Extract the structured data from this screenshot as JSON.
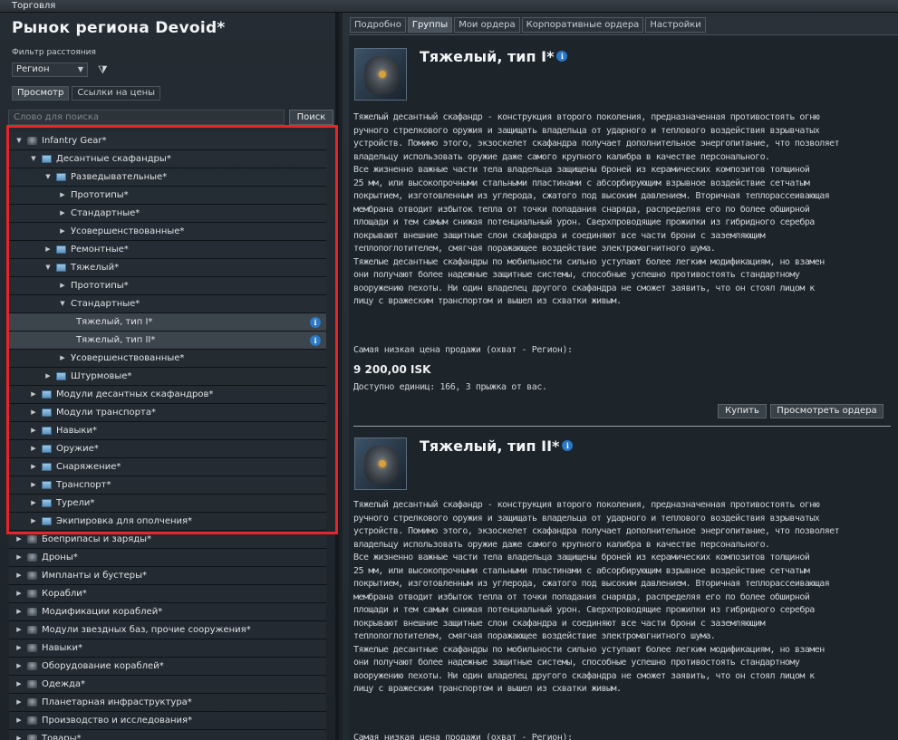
{
  "window": {
    "title": "Торговля"
  },
  "left": {
    "region_title": "Рынок региона Devoid*",
    "filter_label": "Фильтр расстояния",
    "region_select": "Регион",
    "subtabs": [
      "Просмотр",
      "Ссылки на цены"
    ],
    "search": {
      "placeholder": "Слово для поиска",
      "button": "Поиск"
    },
    "tree": [
      {
        "label": "Infantry Gear*",
        "depth": 0,
        "expanded": true,
        "icon": "gear-icon"
      },
      {
        "label": "Десантные скафандры*",
        "depth": 1,
        "expanded": true,
        "icon": "folder-icon"
      },
      {
        "label": "Разведывательные*",
        "depth": 2,
        "expanded": true,
        "icon": "folder-icon"
      },
      {
        "label": "Прототипы*",
        "depth": 3,
        "expanded": false,
        "icon": "none"
      },
      {
        "label": "Стандартные*",
        "depth": 3,
        "expanded": false,
        "icon": "none"
      },
      {
        "label": "Усовершенствованные*",
        "depth": 3,
        "expanded": false,
        "icon": "none"
      },
      {
        "label": "Ремонтные*",
        "depth": 2,
        "expanded": false,
        "icon": "folder-icon"
      },
      {
        "label": "Тяжелый*",
        "depth": 2,
        "expanded": true,
        "icon": "folder-icon"
      },
      {
        "label": "Прототипы*",
        "depth": 3,
        "expanded": false,
        "icon": "none"
      },
      {
        "label": "Стандартные*",
        "depth": 3,
        "expanded": true,
        "icon": "none"
      },
      {
        "label": "Тяжелый, тип I*",
        "depth": 4,
        "leaf": true,
        "info": true,
        "selected": true
      },
      {
        "label": "Тяжелый, тип II*",
        "depth": 4,
        "leaf": true,
        "info": true,
        "selected": true
      },
      {
        "label": "Усовершенствованные*",
        "depth": 3,
        "expanded": false,
        "icon": "none"
      },
      {
        "label": "Штурмовые*",
        "depth": 2,
        "expanded": false,
        "icon": "folder-icon"
      },
      {
        "label": "Модули десантных скафандров*",
        "depth": 1,
        "expanded": false,
        "icon": "folder-icon"
      },
      {
        "label": "Модули транспорта*",
        "depth": 1,
        "expanded": false,
        "icon": "folder-icon"
      },
      {
        "label": "Навыки*",
        "depth": 1,
        "expanded": false,
        "icon": "folder-icon"
      },
      {
        "label": "Оружие*",
        "depth": 1,
        "expanded": false,
        "icon": "folder-icon"
      },
      {
        "label": "Снаряжение*",
        "depth": 1,
        "expanded": false,
        "icon": "folder-icon"
      },
      {
        "label": "Транспорт*",
        "depth": 1,
        "expanded": false,
        "icon": "folder-icon"
      },
      {
        "label": "Турели*",
        "depth": 1,
        "expanded": false,
        "icon": "folder-icon"
      },
      {
        "label": "Экипировка для ополчения*",
        "depth": 1,
        "expanded": false,
        "icon": "folder-icon"
      },
      {
        "label": "Боеприпасы и заряды*",
        "depth": 0,
        "expanded": false,
        "icon": "ammo-icon"
      },
      {
        "label": "Дроны*",
        "depth": 0,
        "expanded": false,
        "icon": "drone-icon"
      },
      {
        "label": "Импланты и бустеры*",
        "depth": 0,
        "expanded": false,
        "icon": "implant-icon"
      },
      {
        "label": "Корабли*",
        "depth": 0,
        "expanded": false,
        "icon": "ship-icon"
      },
      {
        "label": "Модификации кораблей*",
        "depth": 0,
        "expanded": false,
        "icon": "ship-mod-icon"
      },
      {
        "label": "Модули звездных баз, прочие сооружения*",
        "depth": 0,
        "expanded": false,
        "icon": "starbase-icon"
      },
      {
        "label": "Навыки*",
        "depth": 0,
        "expanded": false,
        "icon": "skillbook-icon"
      },
      {
        "label": "Оборудование кораблей*",
        "depth": 0,
        "expanded": false,
        "icon": "equipment-icon"
      },
      {
        "label": "Одежда*",
        "depth": 0,
        "expanded": false,
        "icon": "clothing-icon"
      },
      {
        "label": "Планетарная инфраструктура*",
        "depth": 0,
        "expanded": false,
        "icon": "planet-icon"
      },
      {
        "label": "Производство и исследования*",
        "depth": 0,
        "expanded": false,
        "icon": "industry-icon"
      },
      {
        "label": "Товары*",
        "depth": 0,
        "expanded": false,
        "icon": "trade-goods-icon"
      }
    ]
  },
  "right": {
    "tabs": [
      "Подробно",
      "Группы",
      "Мои ордера",
      "Корпоративные ордера",
      "Настройки"
    ],
    "active_tab": "Группы",
    "items": [
      {
        "title": "Тяжелый, тип I*",
        "description": "Тяжелый десантный скафандр - конструкция второго поколения, предназначенная противостоять огню\nручного стрелкового оружия и защищать владельца от ударного и теплового воздействия взрывчатых\nустройств. Помимо этого, экзоскелет скафандра получает дополнительное энергопитание, что позволяет\nвладельцу использовать оружие даже самого крупного калибра в качестве персонального.\nВсе жизненно важные части тела владельца защищены броней из керамических композитов толщиной\n25 мм, или высокопрочными стальными пластинами с абсорбирующим взрывное воздействие сетчатым\nпокрытием, изготовленным из углерода, сжатого под высоким давлением. Вторичная теплорассеивающая\nмембрана отводит избыток тепла от точки попадания снаряда, распределяя его по более обширной\nплощади и тем самым снижая потенциальный урон. Сверхпроводящие прожилки из гибридного серебра\nпокрывают внешние защитные слои скафандра и соединяют все части брони с заземляющим\nтеплопоглотителем, смягчая поражающее воздействие электромагнитного шума.\nТяжелые десантные скафандры по мобильности сильно уступают более легким модификациям, но взамен\nони получают более надежные защитные системы, способные успешно противостоять стандартному\nвооружению пехоты. Ни один владелец другого скафандра не сможет заявить, что он стоял лицом к\nлицу с вражеским транспортом и вышел из схватки живым.",
        "price_label": "Самая низкая цена продажи (охват - Регион):",
        "price": "9 200,00 ISK",
        "availability": "Доступно единиц: 166, 3 прыжка от вас.",
        "buy_button": "Купить",
        "orders_button": "Просмотреть ордера"
      },
      {
        "title": "Тяжелый, тип II*",
        "description": "Тяжелый десантный скафандр - конструкция второго поколения, предназначенная противостоять огню\nручного стрелкового оружия и защищать владельца от ударного и теплового воздействия взрывчатых\nустройств. Помимо этого, экзоскелет скафандра получает дополнительное энергопитание, что позволяет\nвладельцу использовать оружие даже самого крупного калибра в качестве персонального.\nВсе жизненно важные части тела владельца защищены броней из керамических композитов толщиной\n25 мм, или высокопрочными стальными пластинами с абсорбирующим взрывное воздействие сетчатым\nпокрытием, изготовленным из углерода, сжатого под высоким давлением. Вторичная теплорассеивающая\nмембрана отводит избыток тепла от точки попадания снаряда, распределяя его по более обширной\nплощади и тем самым снижая потенциальный урон. Сверхпроводящие прожилки из гибридного серебра\nпокрывают внешние защитные слои скафандра и соединяют все части брони с заземляющим\nтеплопоглотителем, смягчая поражающее воздействие электромагнитного шума.\nТяжелые десантные скафандры по мобильности сильно уступают более легким модификациям, но взамен\nони получают более надежные защитные системы, способные успешно противостоять стандартному\nвооружению пехоты. Ни один владелец другого скафандра не сможет заявить, что он стоял лицом к\nлицу с вражеским транспортом и вышел из схватки живым.",
        "price_label": "Самая низкая цена продажи (охват - Регион):"
      }
    ]
  },
  "colors": {
    "highlight_box": "#e8232a",
    "info_icon": "#2a78c8",
    "folder": "#7fb3da"
  }
}
